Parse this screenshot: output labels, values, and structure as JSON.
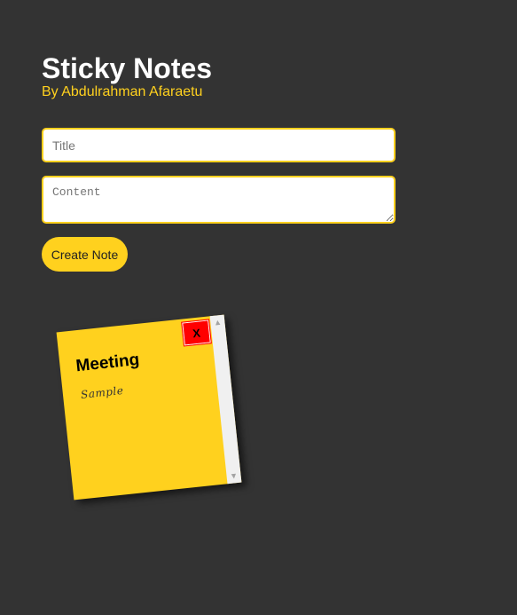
{
  "header": {
    "title": "Sticky Notes",
    "byline": "By Abdulrahman Afaraetu"
  },
  "form": {
    "title_placeholder": "Title",
    "content_placeholder": "Content",
    "create_label": "Create Note"
  },
  "notes": [
    {
      "title": "Meeting",
      "content": "Sample",
      "delete_label": "X"
    }
  ],
  "colors": {
    "background": "#333333",
    "accent": "#ffd11e",
    "note": "#ffd11e",
    "delete": "#ff0000"
  },
  "icons": {
    "scroll_up": "triangle-up-icon",
    "scroll_down": "triangle-down-icon"
  }
}
